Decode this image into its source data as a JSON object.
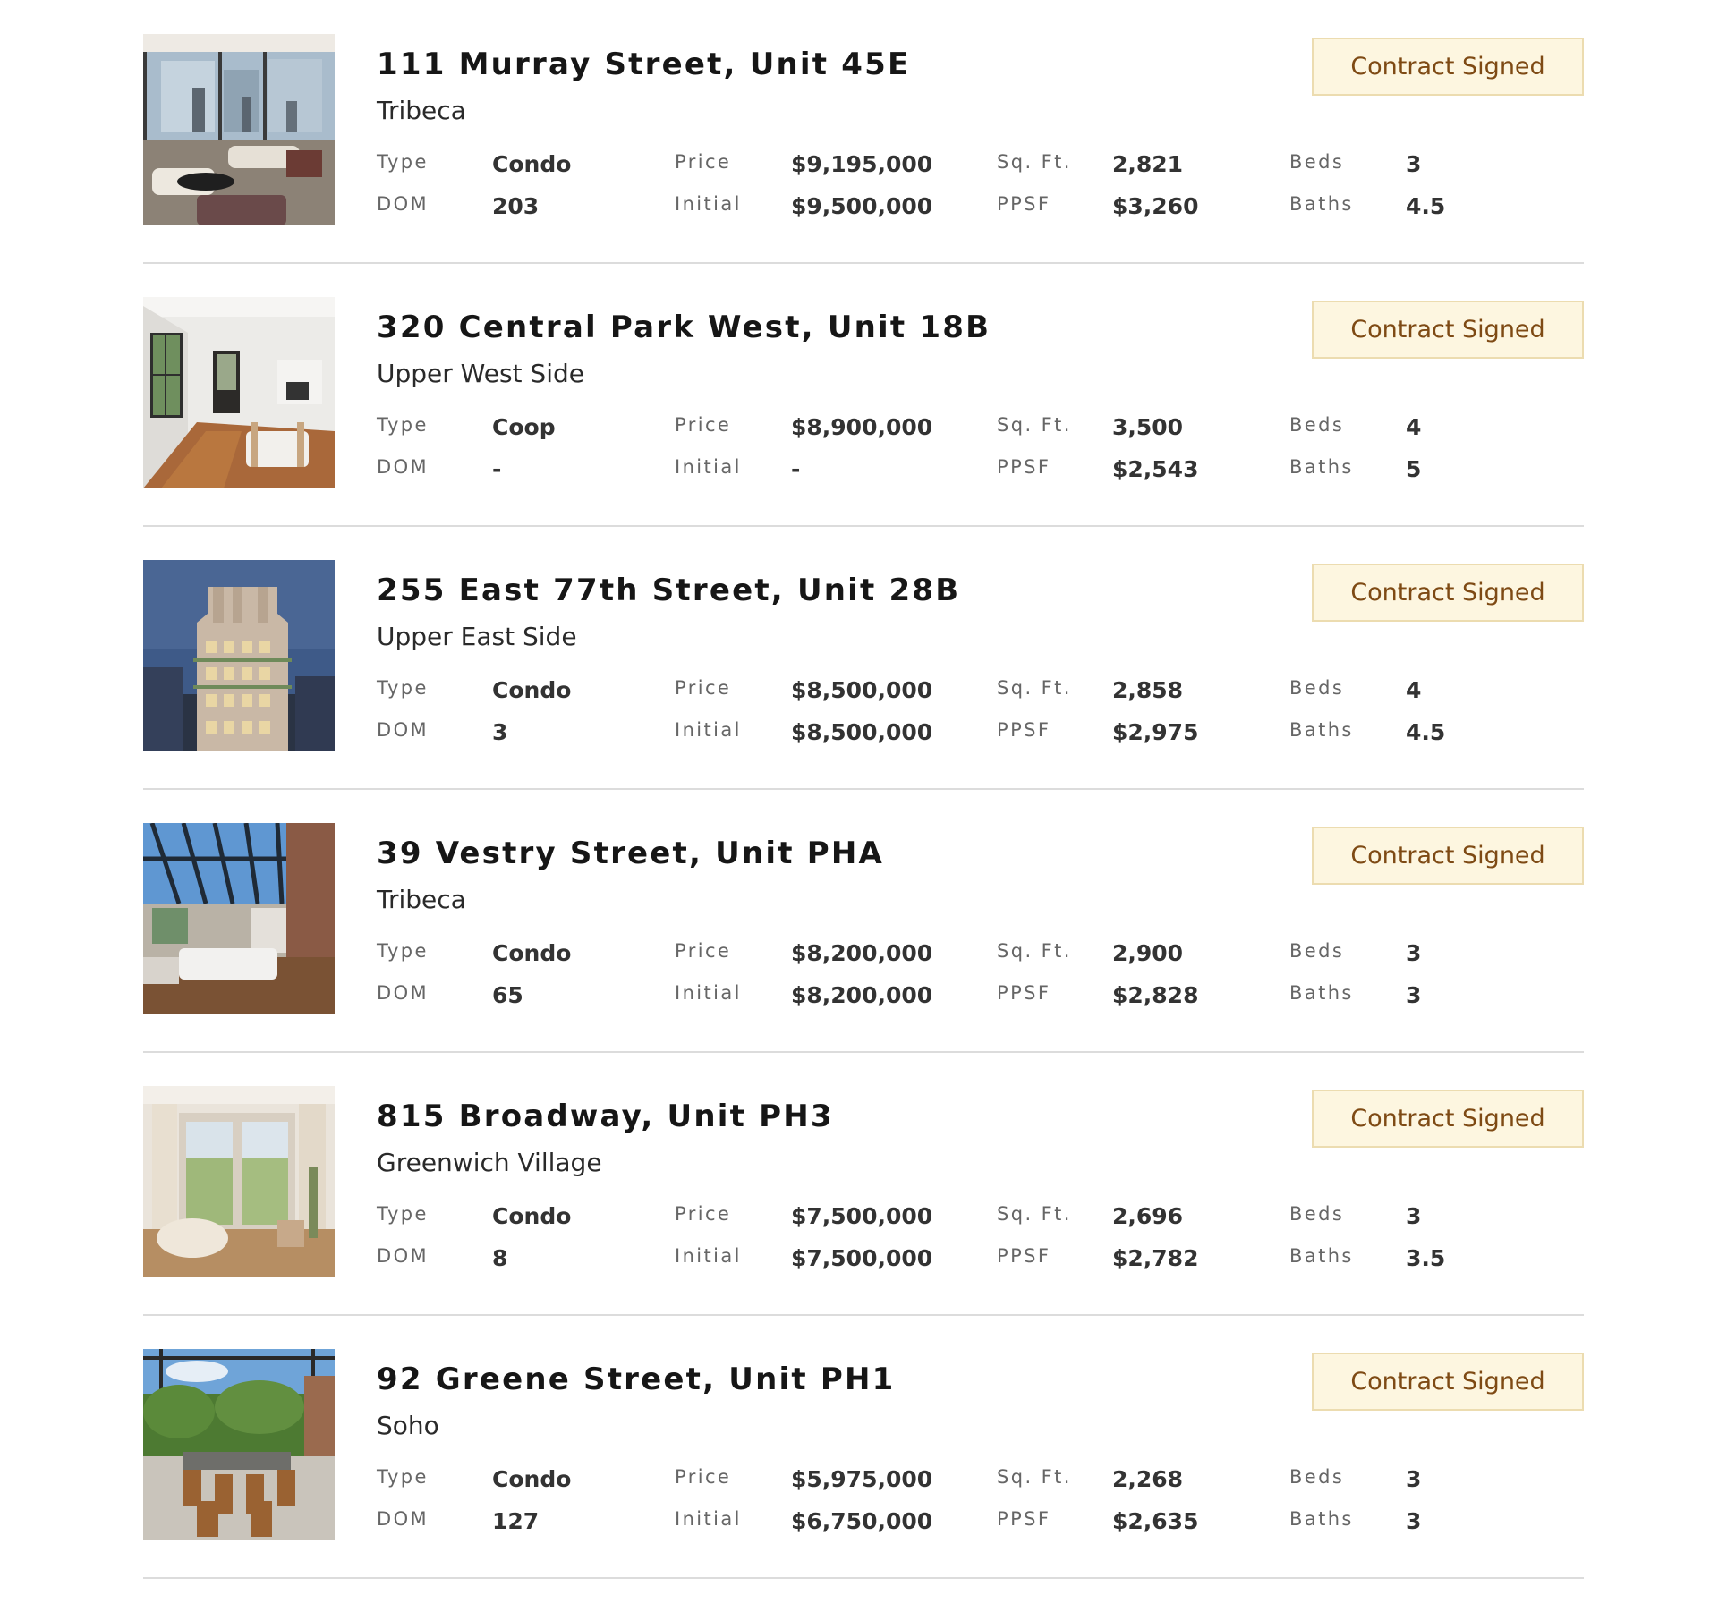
{
  "listings": [
    {
      "address": "111 Murray Street, Unit 45E",
      "neighborhood": "Tribeca",
      "status": "Contract Signed",
      "type_label": "Type",
      "type": "Condo",
      "dom_label": "DOM",
      "dom": "203",
      "price_label": "Price",
      "price": "$9,195,000",
      "initial_label": "Initial",
      "initial": "$9,500,000",
      "sqft_label": "Sq. Ft.",
      "sqft": "2,821",
      "ppsf_label": "PPSF",
      "ppsf": "$3,260",
      "beds_label": "Beds",
      "beds": "3",
      "baths_label": "Baths",
      "baths": "4.5",
      "photo": "living-room-city-view"
    },
    {
      "address": "320 Central Park West, Unit 18B",
      "neighborhood": "Upper West Side",
      "status": "Contract Signed",
      "type_label": "Type",
      "type": "Coop",
      "dom_label": "DOM",
      "dom": "-",
      "price_label": "Price",
      "price": "$8,900,000",
      "initial_label": "Initial",
      "initial": "-",
      "sqft_label": "Sq. Ft.",
      "sqft": "3,500",
      "ppsf_label": "PPSF",
      "ppsf": "$2,543",
      "beds_label": "Beds",
      "beds": "4",
      "baths_label": "Baths",
      "baths": "5",
      "photo": "white-living-room-park-view"
    },
    {
      "address": "255 East 77th Street, Unit 28B",
      "neighborhood": "Upper East Side",
      "status": "Contract Signed",
      "type_label": "Type",
      "type": "Condo",
      "dom_label": "DOM",
      "dom": "3",
      "price_label": "Price",
      "price": "$8,500,000",
      "initial_label": "Initial",
      "initial": "$8,500,000",
      "sqft_label": "Sq. Ft.",
      "sqft": "2,858",
      "ppsf_label": "PPSF",
      "ppsf": "$2,975",
      "beds_label": "Beds",
      "beds": "4",
      "baths_label": "Baths",
      "baths": "4.5",
      "photo": "tower-at-dusk"
    },
    {
      "address": "39 Vestry Street, Unit PHA",
      "neighborhood": "Tribeca",
      "status": "Contract Signed",
      "type_label": "Type",
      "type": "Condo",
      "dom_label": "DOM",
      "dom": "65",
      "price_label": "Price",
      "price": "$8,200,000",
      "initial_label": "Initial",
      "initial": "$8,200,000",
      "sqft_label": "Sq. Ft.",
      "sqft": "2,900",
      "ppsf_label": "PPSF",
      "ppsf": "$2,828",
      "beds_label": "Beds",
      "beds": "3",
      "baths_label": "Baths",
      "baths": "3",
      "photo": "glass-roof-penthouse"
    },
    {
      "address": "815 Broadway, Unit PH3",
      "neighborhood": "Greenwich Village",
      "status": "Contract Signed",
      "type_label": "Type",
      "type": "Condo",
      "dom_label": "DOM",
      "dom": "8",
      "price_label": "Price",
      "price": "$7,500,000",
      "initial_label": "Initial",
      "initial": "$7,500,000",
      "sqft_label": "Sq. Ft.",
      "sqft": "2,696",
      "ppsf_label": "PPSF",
      "ppsf": "$2,782",
      "beds_label": "Beds",
      "beds": "3",
      "baths_label": "Baths",
      "baths": "3.5",
      "photo": "bright-living-room-windows"
    },
    {
      "address": "92 Greene Street, Unit PH1",
      "neighborhood": "Soho",
      "status": "Contract Signed",
      "type_label": "Type",
      "type": "Condo",
      "dom_label": "DOM",
      "dom": "127",
      "price_label": "Price",
      "price": "$5,975,000",
      "initial_label": "Initial",
      "initial": "$6,750,000",
      "sqft_label": "Sq. Ft.",
      "sqft": "2,268",
      "ppsf_label": "PPSF",
      "ppsf": "$2,635",
      "beds_label": "Beds",
      "beds": "3",
      "baths_label": "Baths",
      "baths": "3",
      "photo": "rooftop-terrace-dining"
    }
  ],
  "theme": {
    "badge_bg": "#fdf6e0",
    "badge_border": "#ecdcb0",
    "badge_text": "#7e4a14",
    "divider": "#dcdcdc"
  }
}
